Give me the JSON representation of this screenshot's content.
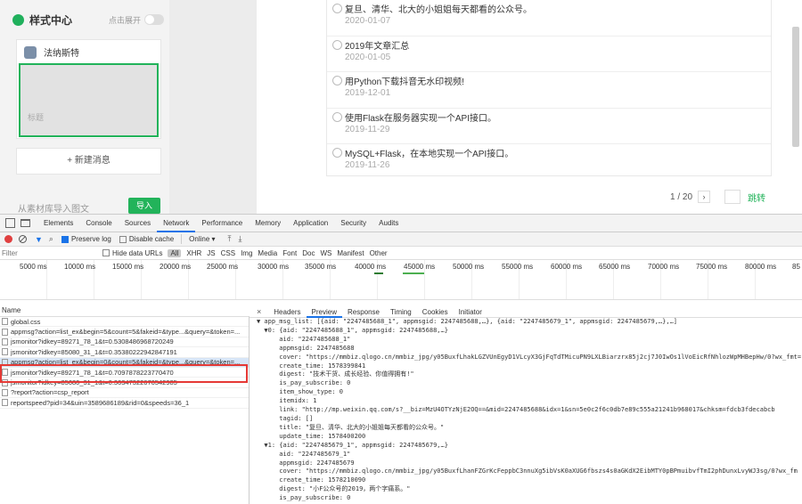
{
  "editor": {
    "title": "样式中心",
    "expand_label": "点击展开",
    "author": "法纳斯特",
    "cover_placeholder": "标题",
    "new_message": "+ 新建消息",
    "import_label": "从素材库导入图文",
    "import_button": "导入"
  },
  "articles": [
    {
      "title": "复旦、清华、北大的小姐姐每天都看的公众号。",
      "date": "2020-01-07"
    },
    {
      "title": "2019年文章汇总",
      "date": "2020-01-05"
    },
    {
      "title": "用Python下载抖音无水印视频!",
      "date": "2019-12-01"
    },
    {
      "title": "使用Flask在服务器实现一个API接口。",
      "date": "2019-11-29"
    },
    {
      "title": "MySQL+Flask，在本地实现一个API接口。",
      "date": "2019-11-26"
    }
  ],
  "pager": {
    "page": "1 / 20",
    "next": "›",
    "jump": "跳转"
  },
  "devtools": {
    "tabs": [
      "Elements",
      "Console",
      "Sources",
      "Network",
      "Performance",
      "Memory",
      "Application",
      "Security",
      "Audits"
    ],
    "toolbar": {
      "preserve_log": "Preserve log",
      "disable_cache": "Disable cache",
      "throttle": "Online ▾"
    },
    "filter": {
      "placeholder": "Filter",
      "hide_data_urls": "Hide data URLs",
      "types": [
        "All",
        "XHR",
        "JS",
        "CSS",
        "Img",
        "Media",
        "Font",
        "Doc",
        "WS",
        "Manifest",
        "Other"
      ]
    },
    "ticks": [
      "5000 ms",
      "10000 ms",
      "15000 ms",
      "20000 ms",
      "25000 ms",
      "30000 ms",
      "35000 ms",
      "40000 ms",
      "45000 ms",
      "50000 ms",
      "55000 ms",
      "60000 ms",
      "65000 ms",
      "70000 ms",
      "75000 ms",
      "80000 ms",
      "85"
    ],
    "name_header": "Name",
    "requests": [
      "global.css",
      "appmsg?action=list_ex&begin=5&count=5&fakeid=&type...&query=&token=...",
      "jsmonitor?idkey=89271_78_1&t=0.5308486968720249",
      "jsmonitor?idkey=85080_31_1&t=0.35380222942847191",
      "appmsg?action=list_ex&begin=0&count=5&fakeid=&type...&query=&token=...",
      "jsmonitor?idkey=89271_78_1&t=0.7097878223770470",
      "jsmonitor?idkey=85080_31_1&t=0.30347322676542985",
      "?report?action=csp_report",
      "reportspeed?pid=34&uin=3589686189&rid=0&speeds=36_1"
    ],
    "detail_tabs": [
      "Headers",
      "Preview",
      "Response",
      "Timing",
      "Cookies",
      "Initiator"
    ],
    "close": "×",
    "json_lines": [
      "▼ app_msg_list: [{aid: \"2247485688_1\", appmsgid: 2247485688,…}, {aid: \"2247485679_1\", appmsgid: 2247485679,…},…]",
      "  ▼0: {aid: \"2247485688_1\", appmsgid: 2247485688,…}",
      "      aid: \"2247485688_1\"",
      "      appmsgid: 2247485688",
      "      cover: \"https://mmbiz.qlogo.cn/mmbiz_jpg/y05BuxfLhakLGZVUnEgyD1VLcyX3GjFqTdTMicuPN9LXLBiarzrx85j2cj7J0IwOs1lVoEicRfNhlozWpMHBepHw/0?wx_fmt=",
      "      create_time: 1578399841",
      "      digest: \"技术干货、成长经验、你值得拥有!\"",
      "      is_pay_subscribe: 0",
      "      item_show_type: 0",
      "      itemidx: 1",
      "      link: \"http://mp.weixin.qq.com/s?__biz=MzU4OTYzNjE2OQ==&mid=2247485688&idx=1&sn=5e0c2f6c0db7e89c555a21241b968017&chksm=fdcb3fdecabcb",
      "      tagid: []",
      "      title: \"复旦、清华、北大的小姐姐每天都看的公众号。\"",
      "      update_time: 1578400200",
      "  ▼1: {aid: \"2247485679_1\", appmsgid: 2247485679,…}",
      "      aid: \"2247485679_1\"",
      "      appmsgid: 2247485679",
      "      cover: \"https://mmbiz.qlogo.cn/mmbiz_jpg/y05BuxfLhanFZGrKcFeppbC3nnuXg5ibVsK0aXUG6fbszs4s0aGKdX2EibMTY0pBPmuibvfTmI2phDunxLvyWJ3sg/0?wx_fm",
      "      create_time: 1578210090",
      "      digest: \"小F公众号的2019，两个字痛系。\"",
      "      is_pay_subscribe: 0"
    ]
  }
}
